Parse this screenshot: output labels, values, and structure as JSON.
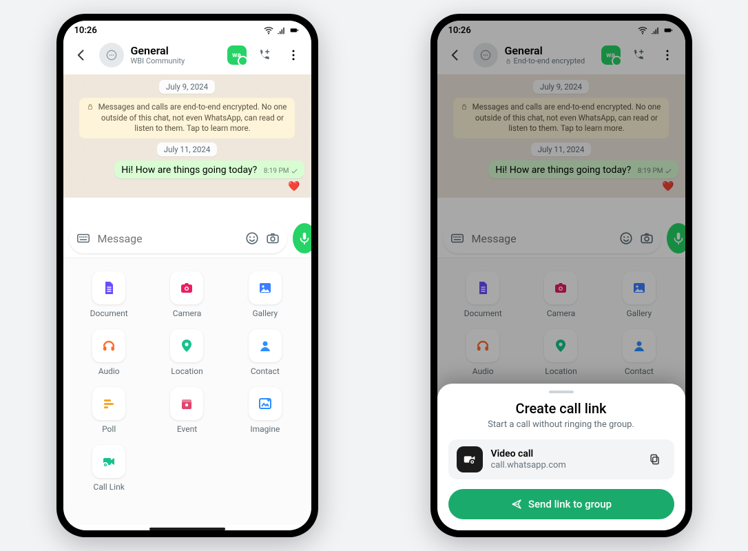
{
  "statusbar": {
    "time": "10:26"
  },
  "header": {
    "title": "General",
    "subtitle": "WBI Community",
    "subtitle_encrypted": "End-to-end encrypted"
  },
  "chat": {
    "date1": "July 9, 2024",
    "encryption_notice": "Messages and calls are end-to-end encrypted. No one outside of this chat, not even WhatsApp, can read or listen to them. Tap to learn more.",
    "date2": "July 11, 2024",
    "message": "Hi! How are things going today?",
    "timestamp": "8:19 PM"
  },
  "composer": {
    "placeholder": "Message"
  },
  "attach": {
    "items": [
      {
        "label": "Document",
        "icon": "document",
        "color": "#6b4cff"
      },
      {
        "label": "Camera",
        "icon": "camera",
        "color": "#e91e63"
      },
      {
        "label": "Gallery",
        "icon": "gallery",
        "color": "#3a7fff"
      },
      {
        "label": "Audio",
        "icon": "audio",
        "color": "#ff6b2d"
      },
      {
        "label": "Location",
        "icon": "location",
        "color": "#17c28d"
      },
      {
        "label": "Contact",
        "icon": "contact",
        "color": "#2e8fff"
      },
      {
        "label": "Poll",
        "icon": "poll",
        "color": "#f5a623"
      },
      {
        "label": "Event",
        "icon": "event",
        "color": "#e0456e"
      },
      {
        "label": "Imagine",
        "icon": "imagine",
        "color": "#2e8fff"
      },
      {
        "label": "Call Link",
        "icon": "calllink",
        "color": "#17c28d"
      }
    ]
  },
  "sheet": {
    "title": "Create call link",
    "subtitle": "Start a call without ringing the group.",
    "link_type": "Video call",
    "link_url": "call.whatsapp.com",
    "send_label": "Send link to group"
  }
}
